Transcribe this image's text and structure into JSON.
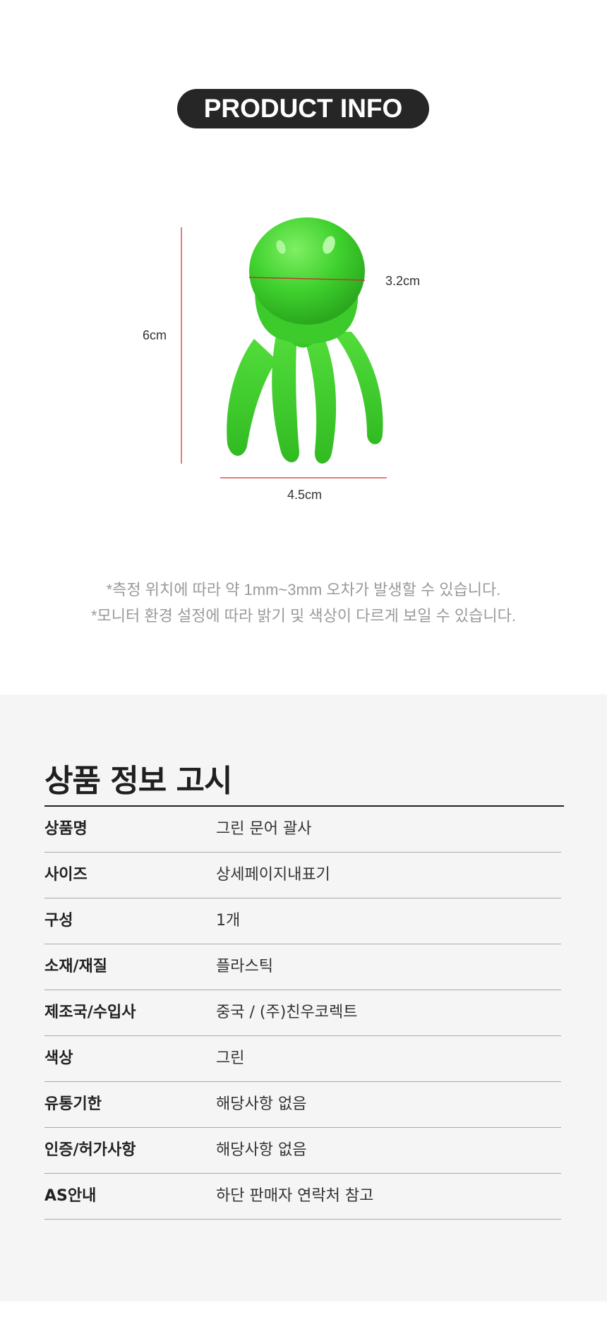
{
  "header": {
    "badge_label": "PRODUCT INFO"
  },
  "product_figure": {
    "dimensions": {
      "height": "6cm",
      "head_width": "3.2cm",
      "width": "4.5cm"
    },
    "product_color": "#3fd12e"
  },
  "notes": [
    "*측정 위치에 따라 약 1mm~3mm 오차가 발생할 수 있습니다.",
    "*모니터 환경 설정에 따라 밝기 및 색상이 다르게 보일 수 있습니다."
  ],
  "notice": {
    "title": "상품 정보 고시",
    "rows": [
      {
        "label": "상품명",
        "value": "그린 문어 괄사"
      },
      {
        "label": "사이즈",
        "value": "상세페이지내표기"
      },
      {
        "label": "구성",
        "value": "1개"
      },
      {
        "label": "소재/재질",
        "value": "플라스틱"
      },
      {
        "label": "제조국/수입사",
        "value": "중국 / (주)친우코렉트"
      },
      {
        "label": "색상",
        "value": "그린"
      },
      {
        "label": "유통기한",
        "value": "해당사항 없음"
      },
      {
        "label": "인증/허가사항",
        "value": "해당사항 없음"
      },
      {
        "label": "AS안내",
        "value": "하단 판매자 연락처 참고"
      }
    ]
  }
}
